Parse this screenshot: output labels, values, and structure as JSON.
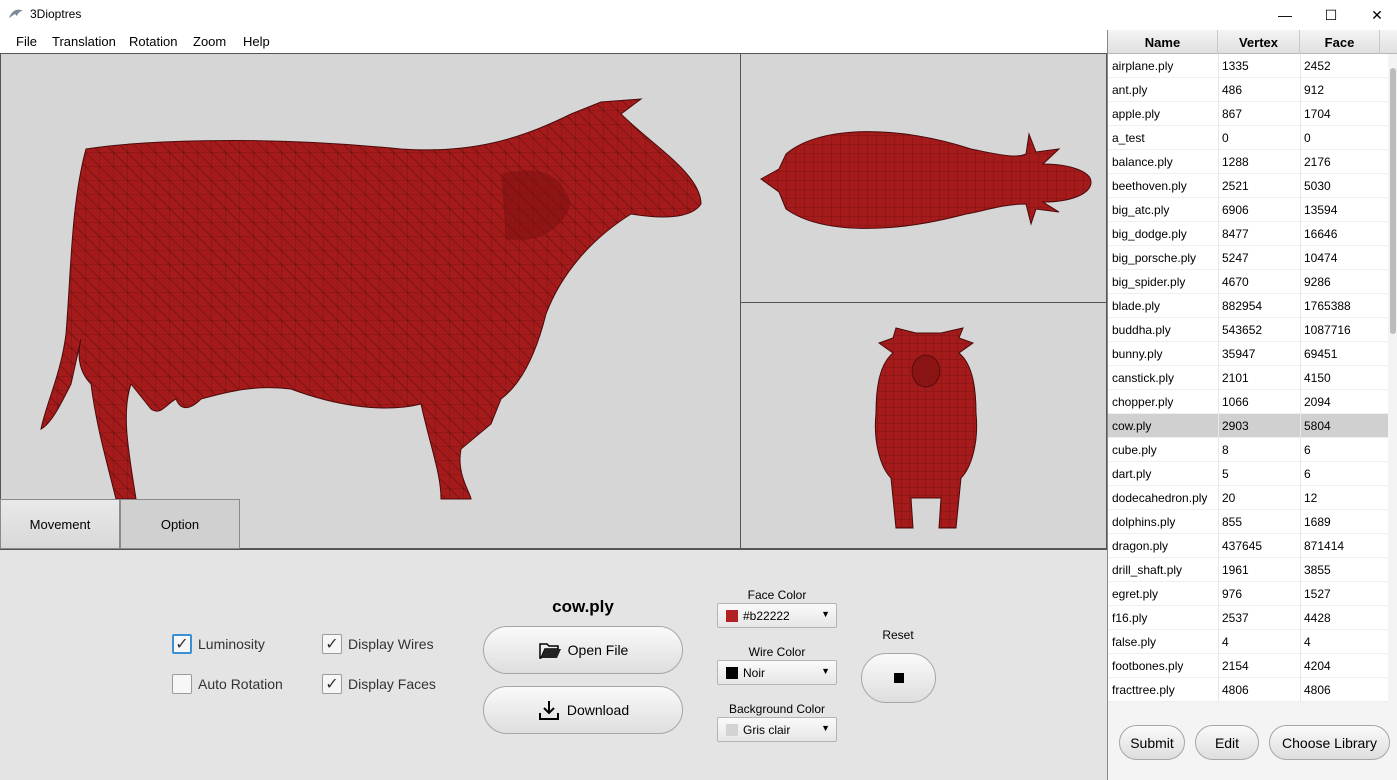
{
  "window": {
    "title": "3Dioptres",
    "minimize": "—",
    "maximize": "☐",
    "close": "✕"
  },
  "menu": [
    "File",
    "Translation",
    "Rotation",
    "Zoom",
    "Help"
  ],
  "tabs": {
    "movement": "Movement",
    "option": "Option"
  },
  "options": {
    "luminosity": {
      "label": "Luminosity",
      "checked": true
    },
    "auto_rotation": {
      "label": "Auto Rotation",
      "checked": false
    },
    "display_wires": {
      "label": "Display Wires",
      "checked": true
    },
    "display_faces": {
      "label": "Display Faces",
      "checked": true
    }
  },
  "file": {
    "name": "cow.ply",
    "open_label": "Open File",
    "download_label": "Download"
  },
  "colors": {
    "face": {
      "label": "Face Color",
      "value": "#b22222",
      "swatch": "#b22222"
    },
    "wire": {
      "label": "Wire Color",
      "value": "Noir",
      "swatch": "#000000"
    },
    "background": {
      "label": "Background Color",
      "value": "Gris clair",
      "swatch": "#d3d3d3"
    }
  },
  "reset_label": "Reset",
  "table": {
    "headers": [
      "Name",
      "Vertex",
      "Face"
    ],
    "selected": "cow.ply",
    "rows": [
      [
        "airplane.ply",
        "1335",
        "2452"
      ],
      [
        "ant.ply",
        "486",
        "912"
      ],
      [
        "apple.ply",
        "867",
        "1704"
      ],
      [
        "a_test",
        "0",
        "0"
      ],
      [
        "balance.ply",
        "1288",
        "2176"
      ],
      [
        "beethoven.ply",
        "2521",
        "5030"
      ],
      [
        "big_atc.ply",
        "6906",
        "13594"
      ],
      [
        "big_dodge.ply",
        "8477",
        "16646"
      ],
      [
        "big_porsche.ply",
        "5247",
        "10474"
      ],
      [
        "big_spider.ply",
        "4670",
        "9286"
      ],
      [
        "blade.ply",
        "882954",
        "1765388"
      ],
      [
        "buddha.ply",
        "543652",
        "1087716"
      ],
      [
        "bunny.ply",
        "35947",
        "69451"
      ],
      [
        "canstick.ply",
        "2101",
        "4150"
      ],
      [
        "chopper.ply",
        "1066",
        "2094"
      ],
      [
        "cow.ply",
        "2903",
        "5804"
      ],
      [
        "cube.ply",
        "8",
        "6"
      ],
      [
        "dart.ply",
        "5",
        "6"
      ],
      [
        "dodecahedron.ply",
        "20",
        "12"
      ],
      [
        "dolphins.ply",
        "855",
        "1689"
      ],
      [
        "dragon.ply",
        "437645",
        "871414"
      ],
      [
        "drill_shaft.ply",
        "1961",
        "3855"
      ],
      [
        "egret.ply",
        "976",
        "1527"
      ],
      [
        "f16.ply",
        "2537",
        "4428"
      ],
      [
        "false.ply",
        "4",
        "4"
      ],
      [
        "footbones.ply",
        "2154",
        "4204"
      ],
      [
        "fracttree.ply",
        "4806",
        "4806"
      ]
    ]
  },
  "panel_buttons": {
    "submit": "Submit",
    "edit": "Edit",
    "choose": "Choose Library"
  }
}
